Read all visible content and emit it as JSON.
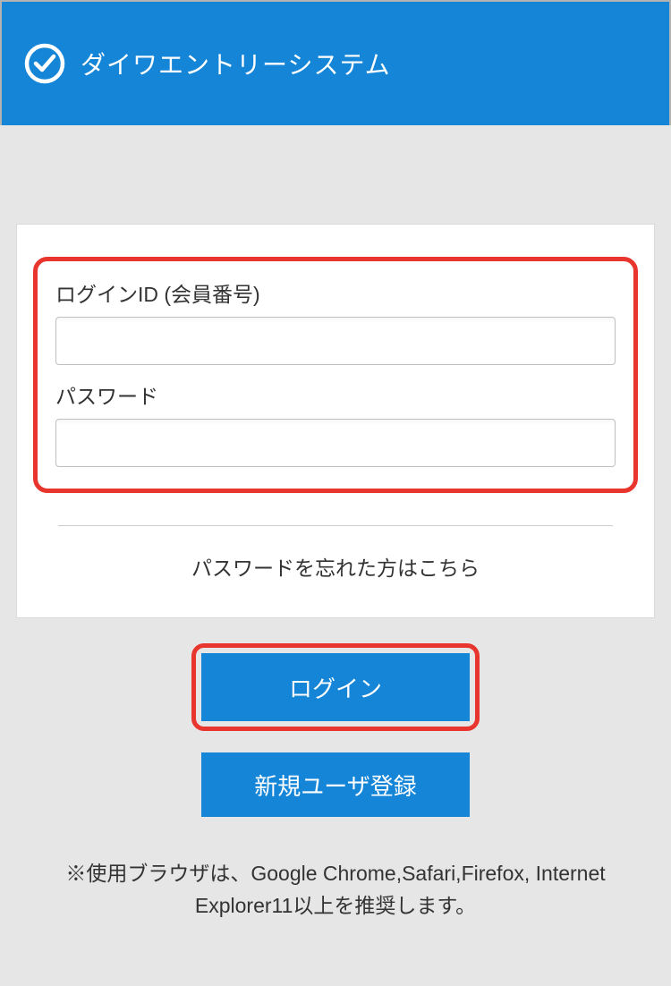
{
  "header": {
    "title": "ダイワエントリーシステム"
  },
  "login": {
    "id_label": "ログインID (会員番号)",
    "password_label": "パスワード",
    "id_value": "",
    "password_value": "",
    "forgot_link": "パスワードを忘れた方はこちら",
    "login_button": "ログイン",
    "register_button": "新規ユーザ登録"
  },
  "footer": {
    "browser_note": "※使用ブラウザは、Google Chrome,Safari,Firefox, Internet Explorer11以上を推奨します。"
  }
}
